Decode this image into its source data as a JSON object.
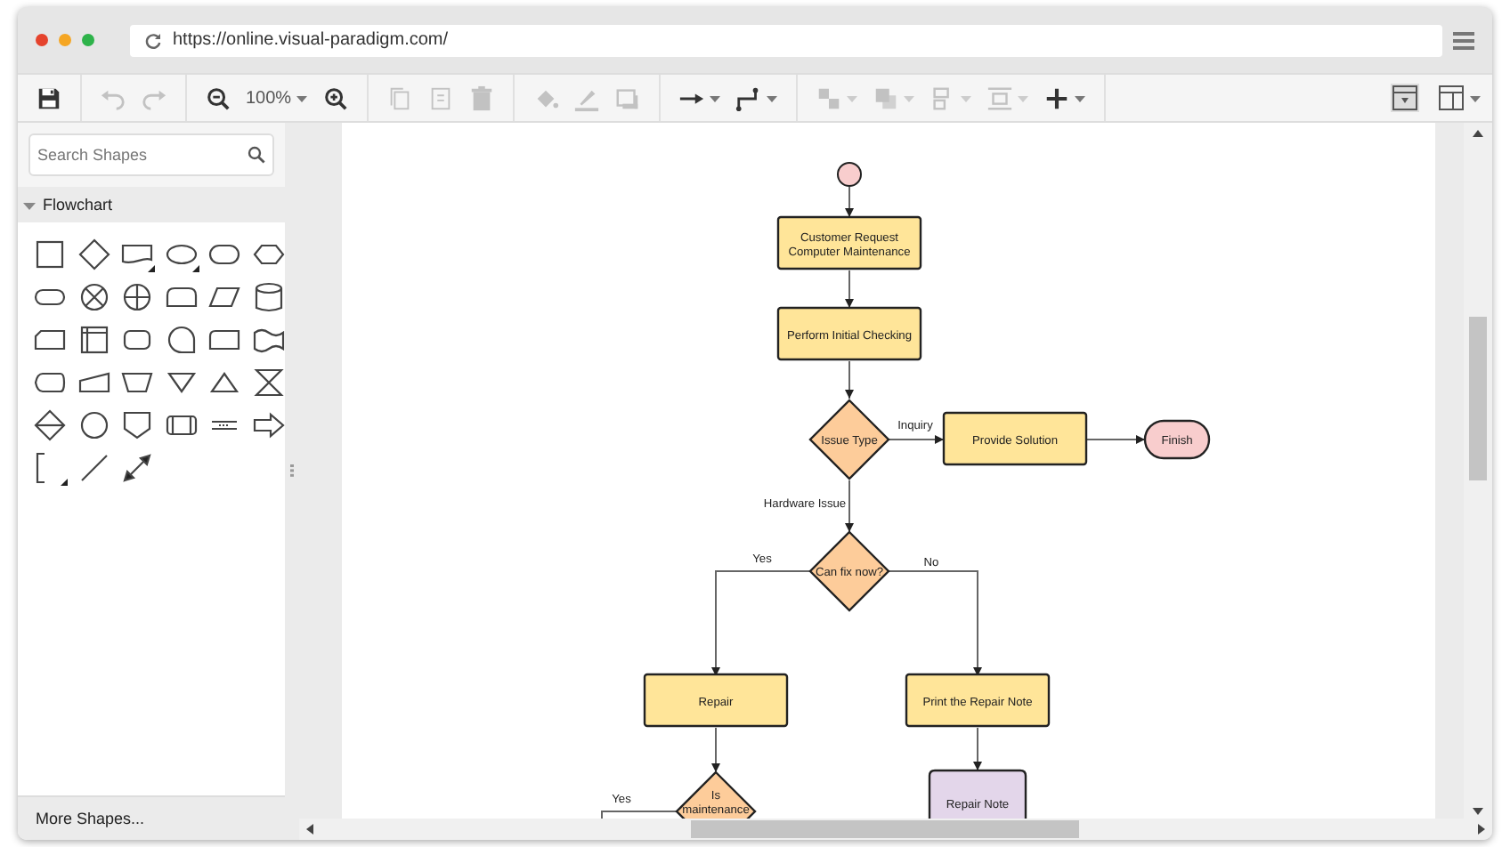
{
  "browser": {
    "url": "https://online.visual-paradigm.com/"
  },
  "toolbar": {
    "groups": [
      [
        {
          "kind": "save",
          "disabled": false
        }
      ],
      [
        {
          "kind": "undo",
          "disabled": true
        },
        {
          "kind": "redo",
          "disabled": true
        }
      ],
      [
        {
          "kind": "zoom-out",
          "disabled": false
        },
        {
          "kind": "zoom-level",
          "text": "100%",
          "dropdown": true,
          "disabled": false
        },
        {
          "kind": "zoom-in",
          "disabled": false
        }
      ],
      [
        {
          "kind": "copy",
          "disabled": true
        },
        {
          "kind": "paste",
          "disabled": true
        },
        {
          "kind": "delete",
          "disabled": true
        }
      ],
      [
        {
          "kind": "fill",
          "disabled": true
        },
        {
          "kind": "line-color",
          "disabled": true
        },
        {
          "kind": "shadow",
          "disabled": true
        }
      ],
      [
        {
          "kind": "arrow",
          "dropdown": true,
          "disabled": false
        },
        {
          "kind": "waypoint",
          "dropdown": true,
          "disabled": false
        }
      ],
      [
        {
          "kind": "group",
          "dropdown": true,
          "disabled": true
        },
        {
          "kind": "order",
          "dropdown": true,
          "disabled": true
        },
        {
          "kind": "align",
          "dropdown": true,
          "disabled": true
        },
        {
          "kind": "distribute",
          "dropdown": true,
          "disabled": true
        },
        {
          "kind": "insert",
          "dropdown": true,
          "disabled": false
        }
      ]
    ],
    "panel_toggles": [
      {
        "kind": "format-panel",
        "selected": true
      },
      {
        "kind": "layout",
        "dropdown": true,
        "selected": false
      }
    ]
  },
  "sidebar": {
    "search": {
      "placeholder": "Search Shapes"
    },
    "sections": [
      {
        "title": "Flowchart",
        "expanded": true
      }
    ],
    "footer": "More Shapes..."
  },
  "diagram": {
    "nodes": [
      {
        "kind": "start"
      },
      {
        "kind": "process",
        "label": "Customer Request\nComputer Maintenance"
      },
      {
        "kind": "process",
        "label": "Perform Initial Checking"
      },
      {
        "kind": "decision",
        "label": "Issue Type"
      },
      {
        "kind": "process",
        "label": "Provide Solution"
      },
      {
        "kind": "terminal",
        "label": "Finish"
      },
      {
        "kind": "decision",
        "label": "Can fix now?"
      },
      {
        "kind": "process",
        "label": "Repair"
      },
      {
        "kind": "process",
        "label": "Print the Repair Note"
      },
      {
        "kind": "decision",
        "label": "Is\nmaintenance"
      },
      {
        "kind": "document",
        "label": "Repair Note"
      }
    ],
    "edge_labels": [
      "Inquiry",
      "Hardware Issue",
      "Yes",
      "No",
      "Yes"
    ]
  }
}
